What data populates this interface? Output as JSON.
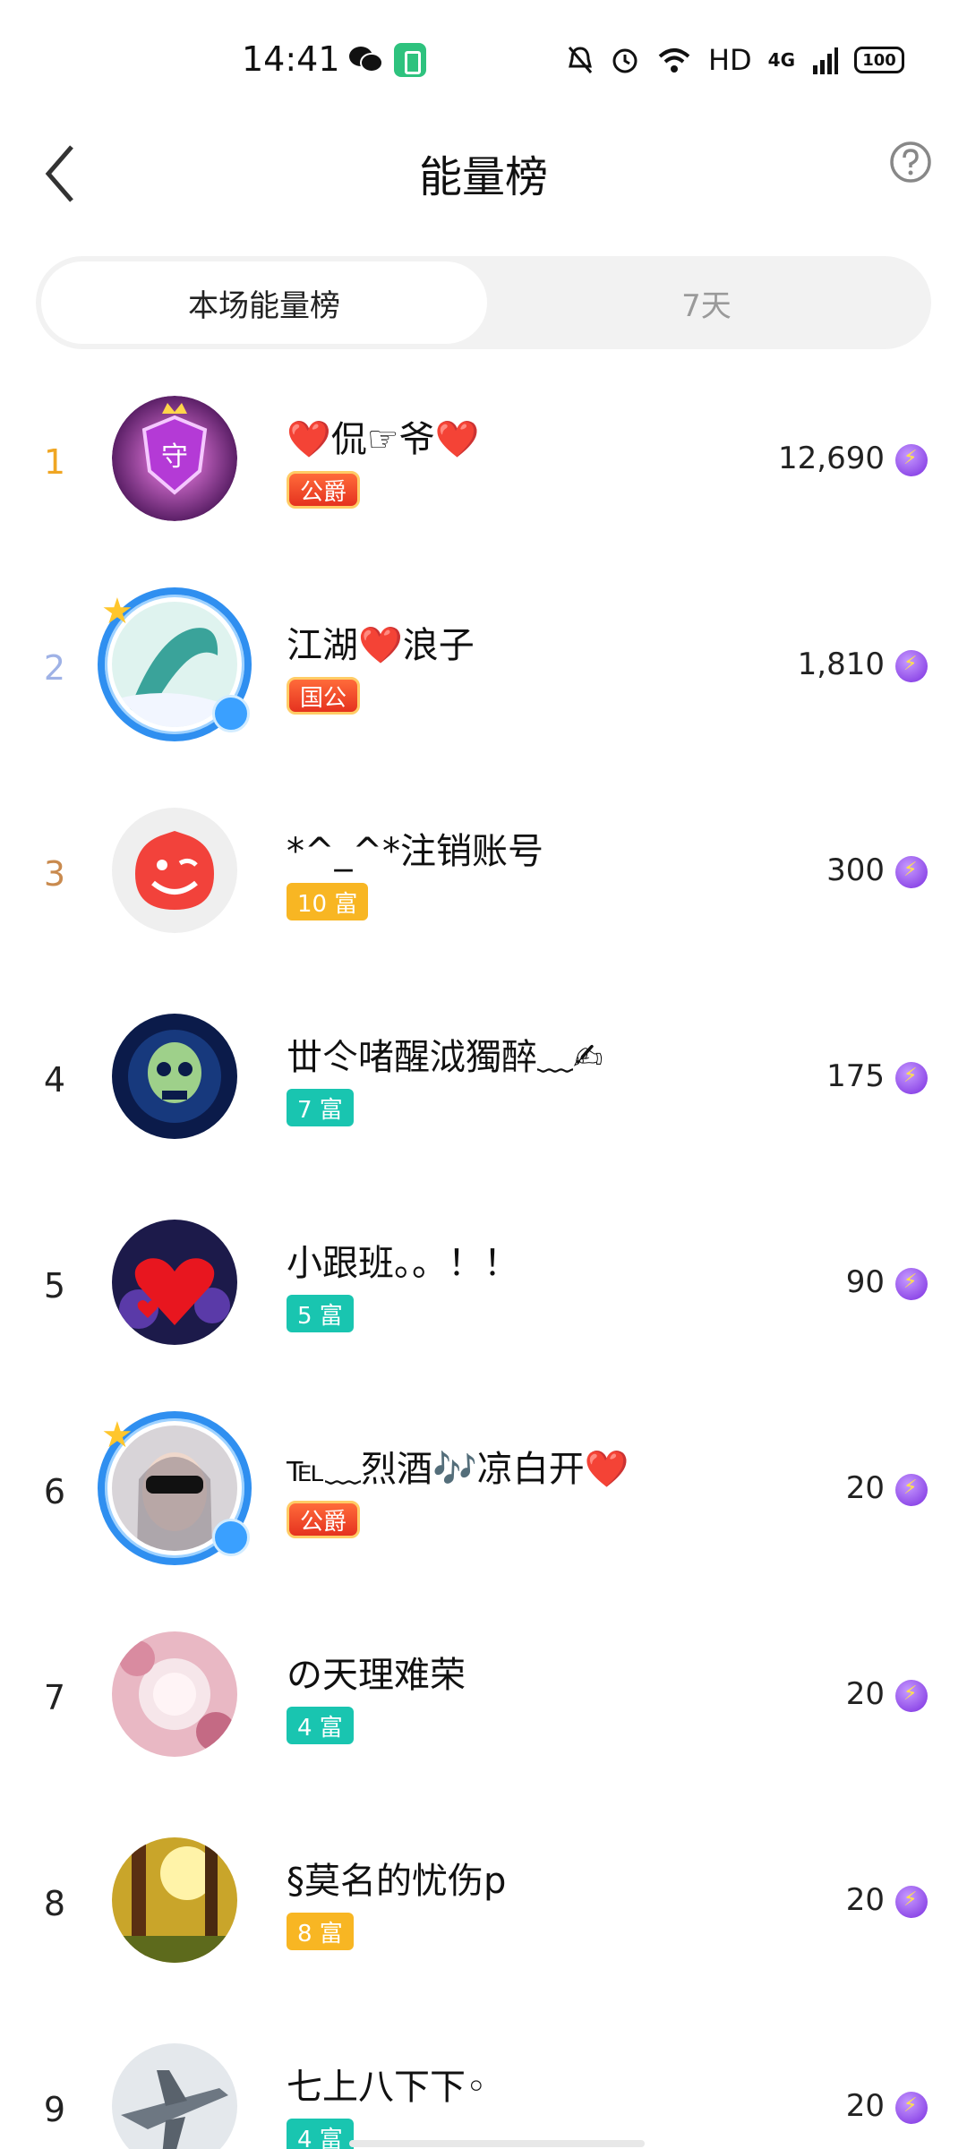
{
  "status_bar": {
    "time": "14:41",
    "hd": "HD",
    "network": "4G",
    "battery": "100"
  },
  "header": {
    "title": "能量榜"
  },
  "tabs": [
    {
      "label": "本场能量榜",
      "active": true
    },
    {
      "label": "7天",
      "active": false
    }
  ],
  "colors": {
    "rank1": "#f0a623",
    "rank2": "#9fb2e6",
    "rank3": "#c98a4e",
    "rank_default": "#222222"
  },
  "list": [
    {
      "rank": "1",
      "name": "❤️侃☞爷❤️",
      "badge": "公爵",
      "score": "12,690"
    },
    {
      "rank": "2",
      "name": "江湖❤️浪子",
      "badge": "国公",
      "score": "1,810"
    },
    {
      "rank": "3",
      "name": "*^_^*注销账号",
      "badge": "10 富",
      "score": "300"
    },
    {
      "rank": "4",
      "name": "丗仒啫醒泧獨醉﹏✍",
      "badge": "7 富",
      "score": "175"
    },
    {
      "rank": "5",
      "name": "小跟班。。！！",
      "badge": "5 富",
      "score": "90"
    },
    {
      "rank": "6",
      "name": "℡﹏烈酒🎶凉白开❤️",
      "badge": "公爵",
      "score": "20"
    },
    {
      "rank": "7",
      "name": "の天理难荣",
      "badge": "4 富",
      "score": "20"
    },
    {
      "rank": "8",
      "name": "§莫名的忧伤p",
      "badge": "8 富",
      "score": "20"
    },
    {
      "rank": "9",
      "name": "七上八下下◦",
      "badge": "4 富",
      "score": "20"
    }
  ]
}
